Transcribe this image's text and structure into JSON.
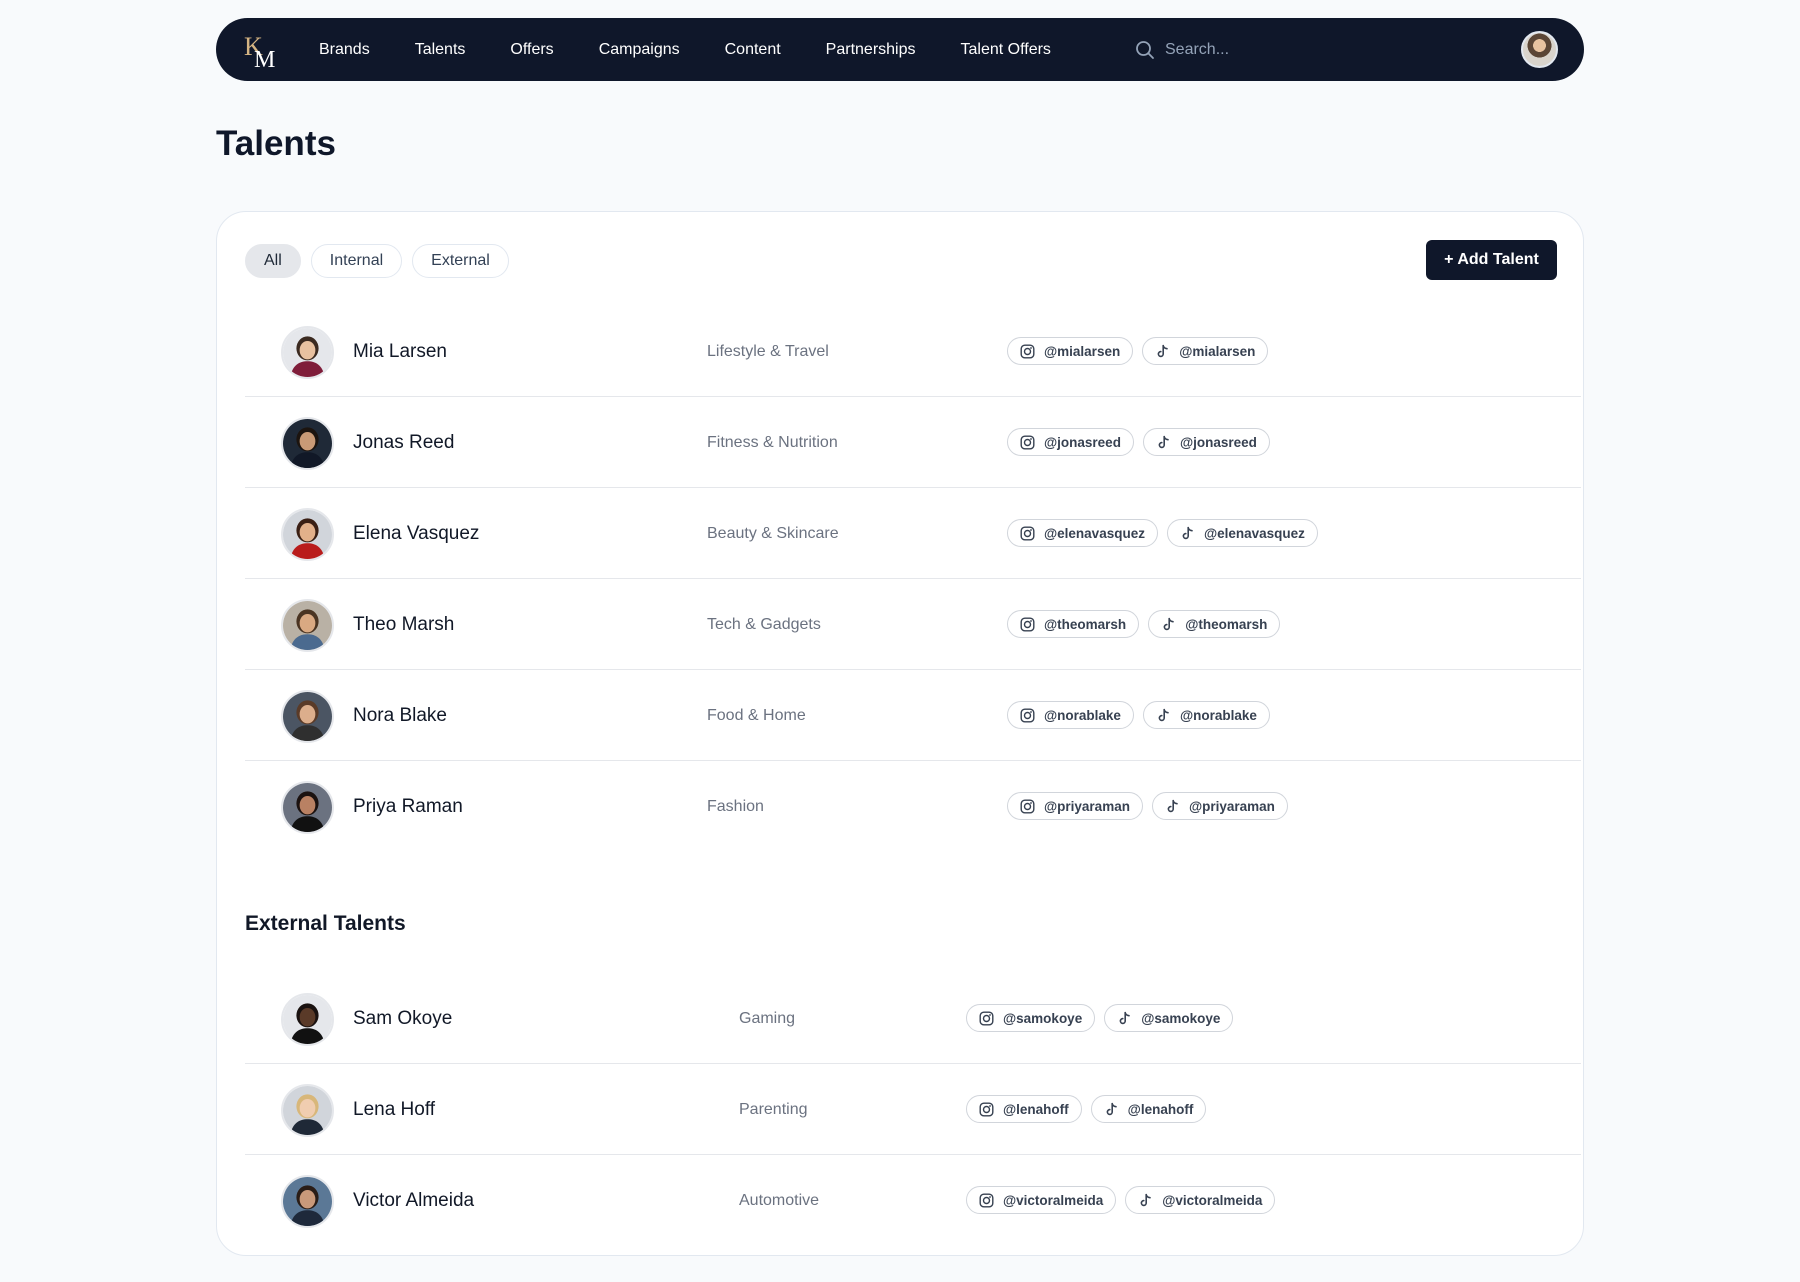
{
  "nav": {
    "logo_text": "KM",
    "links": [
      "Brands",
      "Talents",
      "Offers",
      "Campaigns",
      "Content",
      "Partnerships",
      "Talent Offers"
    ],
    "search_placeholder": "Search..."
  },
  "page": {
    "title": "Talents"
  },
  "filters": {
    "items": [
      "All",
      "Internal",
      "External"
    ],
    "active": "All"
  },
  "actions": {
    "add_label": "+ Add Talent"
  },
  "internal_talents": [
    {
      "name": "Mia Larsen",
      "category": "Lifestyle & Travel",
      "instagram": "@mialarsen",
      "tiktok": "@mialarsen"
    },
    {
      "name": "Jonas Reed",
      "category": "Fitness & Nutrition",
      "instagram": "@jonasreed",
      "tiktok": "@jonasreed"
    },
    {
      "name": "Elena Vasquez",
      "category": "Beauty & Skincare",
      "instagram": "@elenavasquez",
      "tiktok": "@elenavasquez"
    },
    {
      "name": "Theo Marsh",
      "category": "Tech & Gadgets",
      "instagram": "@theomarsh",
      "tiktok": "@theomarsh"
    },
    {
      "name": "Nora Blake",
      "category": "Food & Home",
      "instagram": "@norablake",
      "tiktok": "@norablake"
    },
    {
      "name": "Priya Raman",
      "category": "Fashion",
      "instagram": "@priyaraman",
      "tiktok": "@priyaraman"
    }
  ],
  "external_section": {
    "title": "External Talents"
  },
  "external_talents": [
    {
      "name": "Sam Okoye",
      "category": "Gaming",
      "instagram": "@samokoye",
      "tiktok": "@samokoye"
    },
    {
      "name": "Lena Hoff",
      "category": "Parenting",
      "instagram": "@lenahoff",
      "tiktok": "@lenahoff"
    },
    {
      "name": "Victor Almeida",
      "category": "Automotive",
      "instagram": "@victoralmeida",
      "tiktok": "@victoralmeida"
    }
  ],
  "colors": {
    "nav_bg": "#0f172a",
    "accent": "#0f172a",
    "page_bg": "#f8fafc",
    "logo_gold": "#d4b483"
  }
}
